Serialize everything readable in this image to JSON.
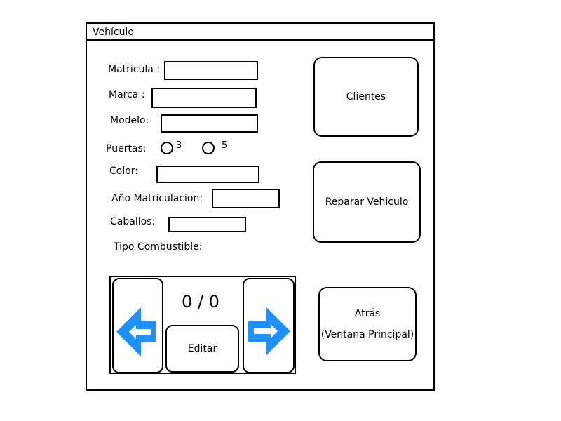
{
  "window": {
    "title": "Vehículo"
  },
  "form": {
    "matricula_label": "Matricula :",
    "matricula_value": "",
    "marca_label": "Marca :",
    "marca_value": "",
    "modelo_label": "Modelo:",
    "modelo_value": "",
    "puertas_label": "Puertas:",
    "puertas_options": [
      "3",
      "5"
    ],
    "color_label": "Color:",
    "color_value": "",
    "anio_label": "Año Matriculacion:",
    "anio_value": "",
    "caballos_label": "Caballos:",
    "caballos_value": "",
    "combustible_label": "Tipo Combustible:"
  },
  "actions": {
    "clientes_label": "Clientes",
    "reparar_label": "Reparar Vehiculo",
    "atras_line1": "Atrás",
    "atras_line2": "(Ventana Principal)"
  },
  "navigator": {
    "counter": "0 / 0",
    "edit_label": "Editar",
    "prev_icon": "arrow-left-icon",
    "next_icon": "arrow-right-icon",
    "arrow_color": "#1e90ff"
  }
}
